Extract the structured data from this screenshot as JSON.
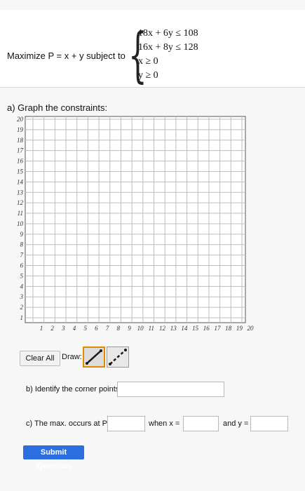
{
  "problem": {
    "maximize_text": "Maximize P = x + y subject to",
    "constraints": [
      "18x + 6y ≤ 108",
      "16x + 8y ≤ 128",
      "x ≥ 0",
      "y ≥ 0"
    ]
  },
  "part_a": {
    "label": "a) Graph the constraints:",
    "y_ticks": [
      "1",
      "2",
      "3",
      "4",
      "5",
      "6",
      "7",
      "8",
      "9",
      "10",
      "11",
      "12",
      "13",
      "14",
      "15",
      "16",
      "17",
      "18",
      "19",
      "20"
    ],
    "x_ticks": [
      "1",
      "2",
      "3",
      "4",
      "5",
      "6",
      "7",
      "8",
      "9",
      "10",
      "11",
      "12",
      "13",
      "14",
      "15",
      "16",
      "17",
      "18",
      "19",
      "20"
    ]
  },
  "tools": {
    "clear_label": "Clear All",
    "draw_label": "Draw:",
    "solid_line_tool": "solid-line-tool-icon",
    "dashed_line_tool": "dashed-line-tool-icon"
  },
  "part_b": {
    "label": "b) Identify the corner points:",
    "value": ""
  },
  "part_c": {
    "prefix": "c) The max. occurs at P =",
    "when_label": "when x =",
    "and_label": "and y =",
    "p_value": "",
    "x_value": "",
    "y_value": ""
  },
  "submit_label": "Submit Question",
  "colors": {
    "accent": "#2a6ee0",
    "active_tool_border": "#e08a00",
    "line_tool": "#1a1a1a"
  }
}
